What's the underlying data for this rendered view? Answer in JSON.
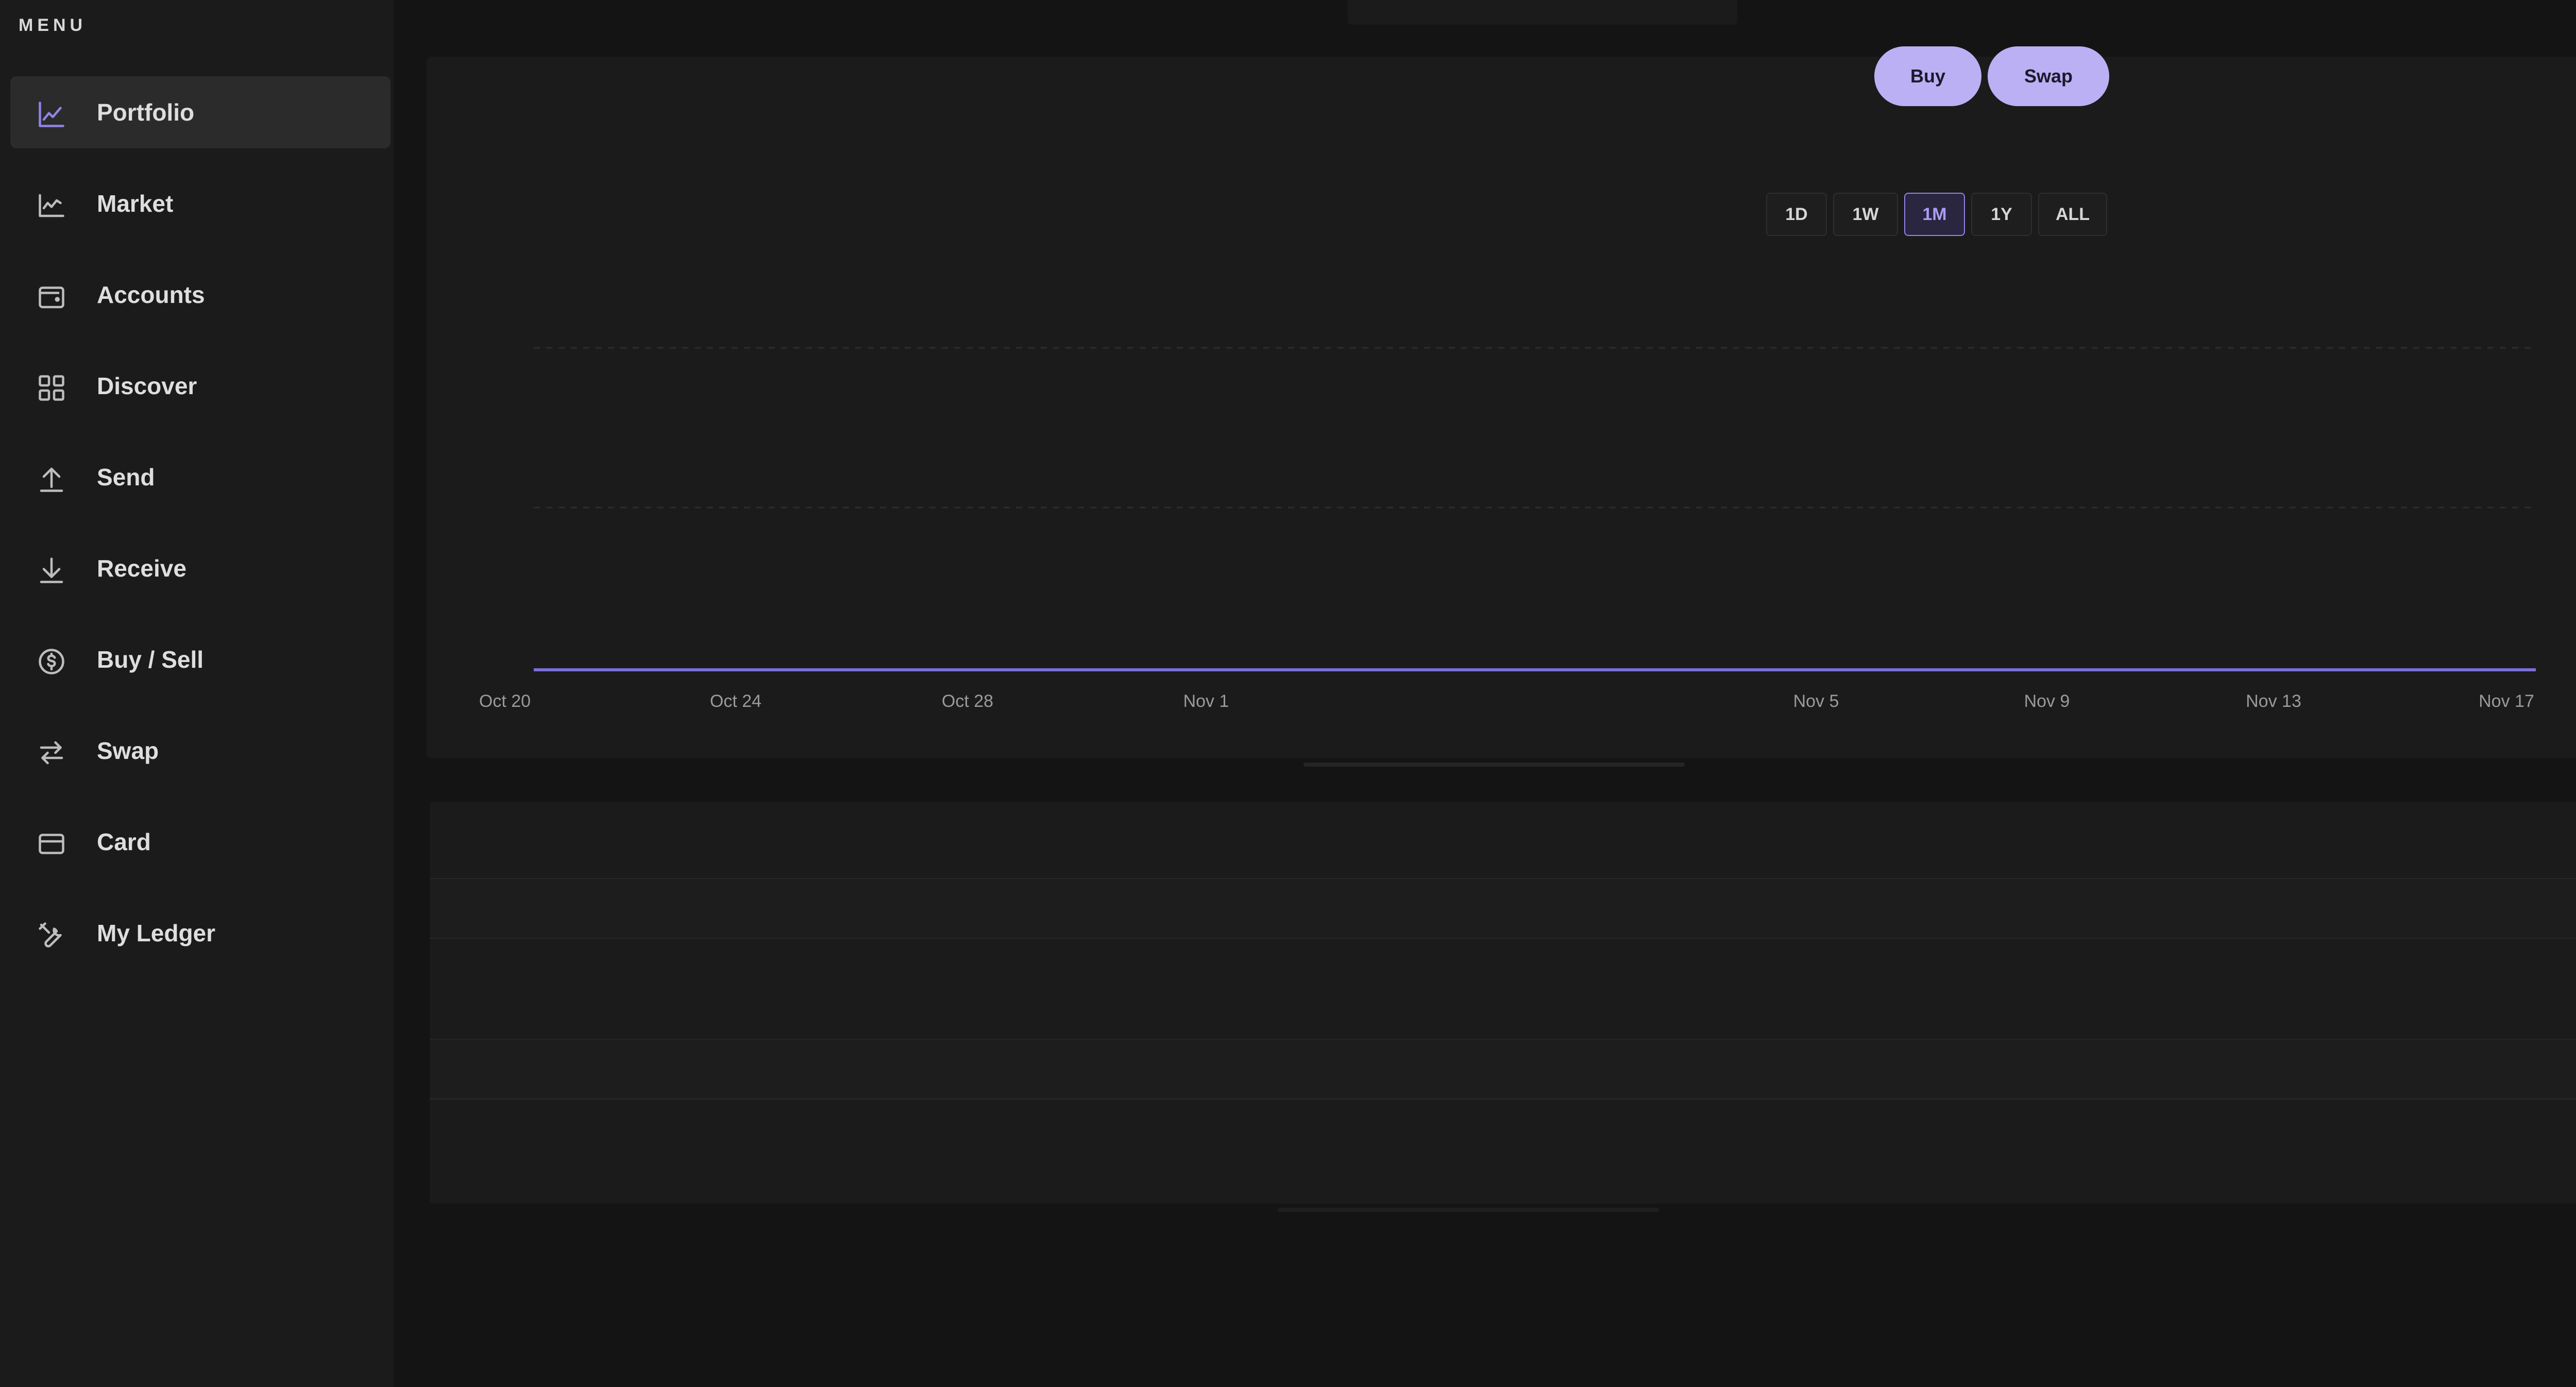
{
  "sidebar": {
    "menu_title": "MENU",
    "items": [
      {
        "label": "Portfolio",
        "icon": "chart-line-icon",
        "active": true
      },
      {
        "label": "Market",
        "icon": "market-chart-icon",
        "active": false
      },
      {
        "label": "Accounts",
        "icon": "wallet-icon",
        "active": false
      },
      {
        "label": "Discover",
        "icon": "grid-icon",
        "active": false
      },
      {
        "label": "Send",
        "icon": "arrow-up-icon",
        "active": false
      },
      {
        "label": "Receive",
        "icon": "arrow-down-icon",
        "active": false
      },
      {
        "label": "Buy / Sell",
        "icon": "dollar-circle-icon",
        "active": false
      },
      {
        "label": "Swap",
        "icon": "swap-arrows-icon",
        "active": false
      },
      {
        "label": "Card",
        "icon": "credit-card-icon",
        "active": false
      },
      {
        "label": "My Ledger",
        "icon": "tools-icon",
        "active": false
      }
    ]
  },
  "actions": {
    "buy_label": "Buy",
    "swap_label": "Swap"
  },
  "range": {
    "options": [
      "1D",
      "1W",
      "1M",
      "1Y",
      "ALL"
    ],
    "selected": "1M"
  },
  "colors": {
    "accent": "#bbb0f4",
    "line": "#7b6fd8",
    "background": "#141414",
    "panel": "#1b1b1b"
  },
  "chart_data": {
    "type": "line",
    "x": [
      "Oct 20",
      "Oct 24",
      "Oct 28",
      "Nov 1",
      "Nov 5",
      "Nov 9",
      "Nov 13",
      "Nov 17"
    ],
    "series": [
      {
        "values": [
          0,
          0,
          0,
          0,
          0,
          0,
          0,
          0
        ]
      }
    ],
    "grid": true
  }
}
